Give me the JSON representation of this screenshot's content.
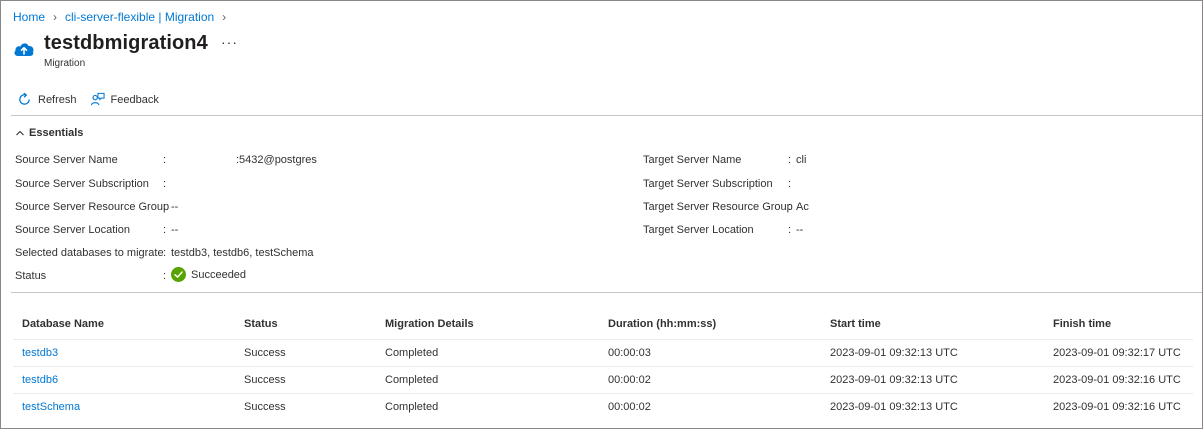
{
  "breadcrumb": {
    "items": [
      "Home",
      "cli-server-flexible | Migration"
    ]
  },
  "header": {
    "title": "testdbmigration4",
    "more": "···",
    "subtitle": "Migration"
  },
  "toolbar": {
    "refresh_label": "Refresh",
    "feedback_label": "Feedback"
  },
  "essentials": {
    "toggle_label": "Essentials",
    "left": [
      {
        "label": "Source Server Name",
        "value": ":5432@postgres"
      },
      {
        "label": "Source Server Subscription",
        "value": ""
      },
      {
        "label": "Source Server Resource Group",
        "value": "--"
      },
      {
        "label": "Source Server Location",
        "value": "--"
      },
      {
        "label": "Selected databases to migrate",
        "value": "testdb3, testdb6, testSchema"
      },
      {
        "label": "Status",
        "value": "Succeeded"
      }
    ],
    "right": [
      {
        "label": "Target Server Name",
        "value": "cli"
      },
      {
        "label": "Target Server Subscription",
        "value": ""
      },
      {
        "label": "Target Server Resource Group",
        "value": "Ac"
      },
      {
        "label": "Target Server Location",
        "value": "--"
      }
    ],
    "colon": ":",
    "status_color": "#57a300"
  },
  "table": {
    "columns": [
      "Database Name",
      "Status",
      "Migration Details",
      "Duration (hh:mm:ss)",
      "Start time",
      "Finish time"
    ],
    "rows": [
      [
        "testdb3",
        "Success",
        "Completed",
        "00:00:03",
        "2023-09-01 09:32:13 UTC",
        "2023-09-01 09:32:17 UTC"
      ],
      [
        "testdb6",
        "Success",
        "Completed",
        "00:00:02",
        "2023-09-01 09:32:13 UTC",
        "2023-09-01 09:32:16 UTC"
      ],
      [
        "testSchema",
        "Success",
        "Completed",
        "00:00:02",
        "2023-09-01 09:32:13 UTC",
        "2023-09-01 09:32:16 UTC"
      ]
    ]
  },
  "colors": {
    "link": "#0078d4",
    "text": "#323130",
    "border": "#c8c6c4"
  },
  "icons": [
    "chevron-right-icon",
    "cloud-upload-icon",
    "refresh-icon",
    "feedback-icon",
    "chevron-up-icon",
    "check-circle-icon"
  ]
}
